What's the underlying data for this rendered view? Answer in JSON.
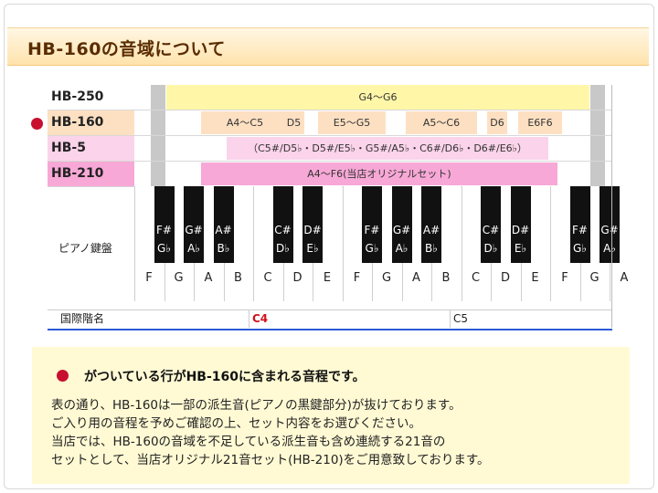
{
  "header": {
    "title": "HB-160の音域について"
  },
  "rows": [
    {
      "label": "HB-250",
      "bg": "#ffffff",
      "segments": [
        {
          "text": "G4〜G6",
          "color": "#fff6a8"
        }
      ]
    },
    {
      "label": "HB-160",
      "bg": "#fde0c2",
      "segments": [
        {
          "text": "A4〜C5"
        },
        {
          "text": "D5"
        },
        {
          "text": "E5〜G5"
        },
        {
          "text": "A5〜C6"
        },
        {
          "text": "D6"
        },
        {
          "text": "E6F6"
        }
      ]
    },
    {
      "label": "HB-5",
      "bg": "#fbd3ea",
      "segments": [
        {
          "text": "（C5#/D5♭・D5#/E5♭・G5#/A5♭・C6#/D6♭・D6#/E6♭）"
        }
      ]
    },
    {
      "label": "HB-210",
      "bg": "#f7a8d6",
      "segments": [
        {
          "text": "A4〜F6(当店オリジナルセット)"
        }
      ]
    }
  ],
  "piano": {
    "label": "ピアノ鍵盤",
    "white_keys": [
      "F",
      "G",
      "A",
      "B",
      "C",
      "D",
      "E",
      "F",
      "G",
      "A",
      "B",
      "C",
      "D",
      "E",
      "F",
      "G",
      "A"
    ],
    "black_keys": [
      {
        "top": "F#",
        "bottom": "G♭"
      },
      {
        "top": "G#",
        "bottom": "A♭"
      },
      {
        "top": "A#",
        "bottom": "B♭"
      },
      {
        "top": "C#",
        "bottom": "D♭"
      },
      {
        "top": "D#",
        "bottom": "E♭"
      },
      {
        "top": "F#",
        "bottom": "G♭"
      },
      {
        "top": "G#",
        "bottom": "A♭"
      },
      {
        "top": "A#",
        "bottom": "B♭"
      },
      {
        "top": "C#",
        "bottom": "D♭"
      },
      {
        "top": "D#",
        "bottom": "E♭"
      },
      {
        "top": "F#",
        "bottom": "G♭"
      },
      {
        "top": "G#",
        "bottom": "A♭"
      }
    ]
  },
  "scale_row": {
    "label": "国際階名",
    "c4": "C4",
    "c5": "C5",
    "c4_color": "#d0101c"
  },
  "note": {
    "headline": "がついている行がHB-160に含まれる音程です。",
    "lines": [
      "表の通り、HB-160は一部の派生音(ピアノの黒鍵部分)が抜けております。",
      "ご入り用の音程を予めご確認の上、セット内容をお選びください。",
      "当店では、HB-160の音域を不足している派生音も含め連続する21音の",
      "セットとして、当店オリジナル21音セット(HB-210)をご用意致しております。"
    ]
  },
  "colors": {
    "accent_red": "#c8102e",
    "header_text": "#5a2c00",
    "gray_column": "#c8c8c8"
  }
}
